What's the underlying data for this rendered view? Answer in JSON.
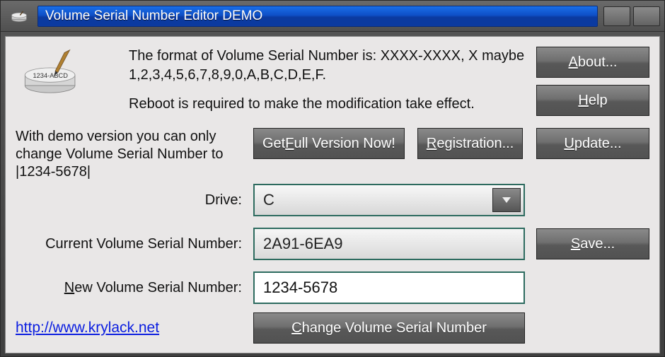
{
  "window": {
    "title": "Volume Serial Number Editor DEMO"
  },
  "info": {
    "line1": "The format of Volume Serial Number is: XXXX-XXXX, X maybe 1,2,3,4,5,6,7,8,9,0,A,B,C,D,E,F.",
    "line2": "Reboot is required to make the modification take effect."
  },
  "demo_note": "With demo version you can only change Volume Serial Number to |1234-5678|",
  "buttons": {
    "about": "About...",
    "help": "Help",
    "get_full": "Get Full Version Now!",
    "registration": "Registration...",
    "update": "Update...",
    "save": "Save...",
    "change": "Change Volume Serial Number"
  },
  "labels": {
    "drive": "Drive:",
    "current": "Current Volume Serial Number:",
    "new": "New Volume Serial Number:"
  },
  "fields": {
    "drive_selected": "C",
    "current_serial": "2A91-6EA9",
    "new_serial": "1234-5678"
  },
  "link": "http://www.krylack.net"
}
